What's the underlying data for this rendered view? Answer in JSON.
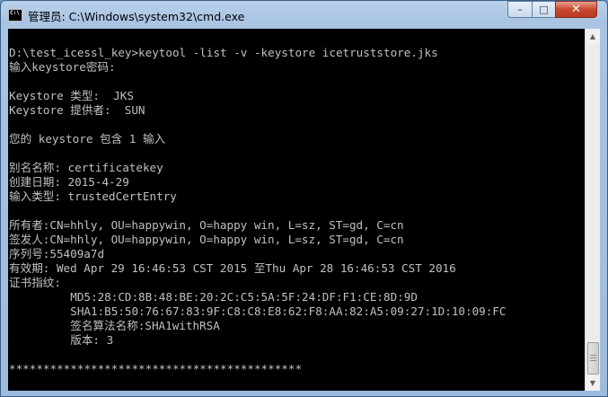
{
  "window": {
    "title": "管理员: C:\\Windows\\system32\\cmd.exe",
    "icon_text": "C:\\",
    "controls": {
      "minimize": "–",
      "maximize": "□",
      "close": "✕"
    }
  },
  "console": {
    "lines": [
      "D:\\test_icessl_key>keytool -list -v -keystore icetruststore.jks",
      "输入keystore密码:",
      "",
      "Keystore 类型:  JKS",
      "Keystore 提供者:  SUN",
      "",
      "您的 keystore 包含 1 输入",
      "",
      "别名名称: certificatekey",
      "创建日期: 2015-4-29",
      "输入类型: trustedCertEntry",
      "",
      "所有者:CN=hhly, OU=happywin, O=happy win, L=sz, ST=gd, C=cn",
      "签发人:CN=hhly, OU=happywin, O=happy win, L=sz, ST=gd, C=cn",
      "序列号:55409a7d",
      "有效期: Wed Apr 29 16:46:53 CST 2015 至Thu Apr 28 16:46:53 CST 2016",
      "证书指纹:",
      "         MD5:28:CD:8B:48:BE:20:2C:C5:5A:5F:24:DF:F1:CE:8D:9D",
      "         SHA1:B5:50:76:67:83:9F:C8:C8:E8:62:F8:AA:82:A5:09:27:1D:10:09:FC",
      "         签名算法名称:SHA1withRSA",
      "         版本: 3",
      "",
      "*******************************************"
    ]
  },
  "scrollbar": {
    "up_arrow": "▲",
    "down_arrow": "▼"
  },
  "colors": {
    "console_bg": "#000000",
    "console_text": "#c0c0c0",
    "close_button": "#c8462e"
  }
}
